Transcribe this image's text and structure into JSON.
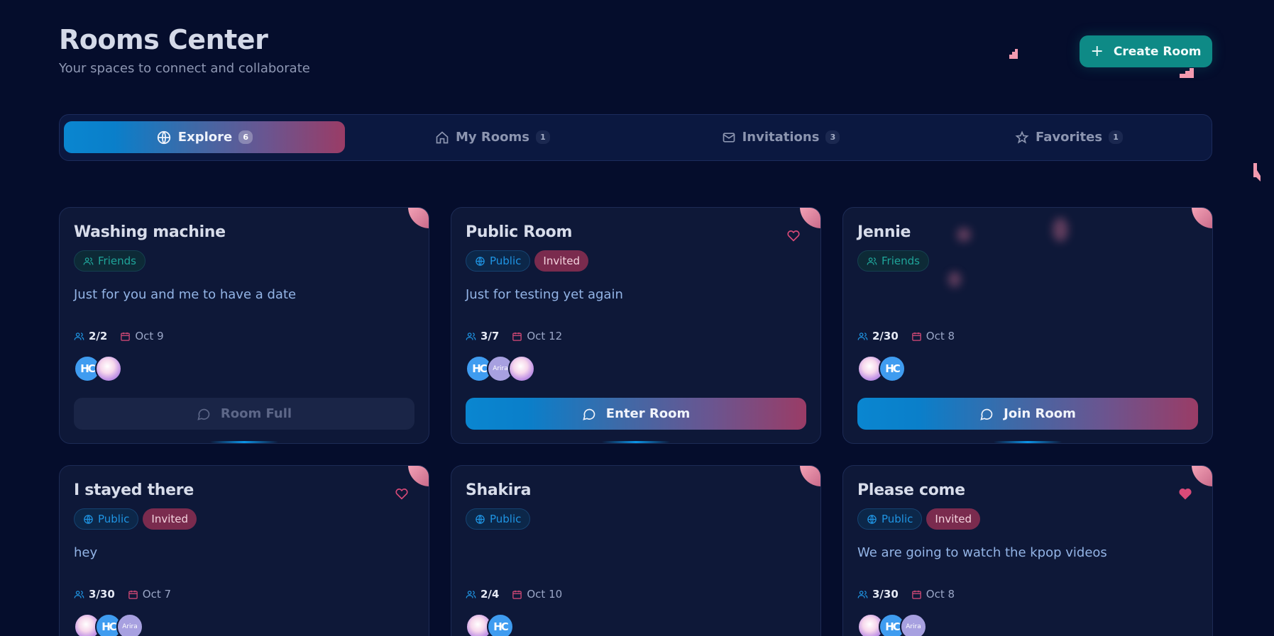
{
  "header": {
    "title": "Rooms Center",
    "subtitle": "Your spaces to connect and collaborate",
    "create_label": "Create Room"
  },
  "tabs": [
    {
      "label": "Explore",
      "count": "6",
      "icon": "globe-icon",
      "active": true
    },
    {
      "label": "My Rooms",
      "count": "1",
      "icon": "home-icon",
      "active": false
    },
    {
      "label": "Invitations",
      "count": "3",
      "icon": "mail-icon",
      "active": false
    },
    {
      "label": "Favorites",
      "count": "1",
      "icon": "star-icon",
      "active": false
    }
  ],
  "cards": [
    {
      "title": "Washing machine",
      "type": "Friends",
      "invited": "",
      "description": "Just for you and me to have a date",
      "members": "2/2",
      "date": "Oct 9",
      "favorite": "none",
      "action": "Room Full",
      "action_state": "disabled"
    },
    {
      "title": "Public Room",
      "type": "Public",
      "invited": "Invited",
      "description": "Just for testing yet again",
      "members": "3/7",
      "date": "Oct 12",
      "favorite": "outline",
      "action": "Enter Room",
      "action_state": "enabled"
    },
    {
      "title": "Jennie",
      "type": "Friends",
      "invited": "",
      "description": "",
      "members": "2/30",
      "date": "Oct 8",
      "favorite": "none",
      "action": "Join Room",
      "action_state": "enabled"
    },
    {
      "title": "I stayed there",
      "type": "Public",
      "invited": "Invited",
      "description": "hey",
      "members": "3/30",
      "date": "Oct 7",
      "favorite": "outline"
    },
    {
      "title": "Shakira",
      "type": "Public",
      "invited": "",
      "description": "",
      "members": "2/4",
      "date": "Oct 10",
      "favorite": "none"
    },
    {
      "title": "Please come",
      "type": "Public",
      "invited": "Invited",
      "description": "We are going to watch the kpop videos",
      "members": "3/30",
      "date": "Oct 8",
      "favorite": "filled"
    }
  ],
  "avatars": {
    "hc": "HC",
    "arira": "Arira"
  },
  "colors": {
    "background": "#050d2c",
    "accent_teal": "#0e8a86",
    "gradient_start": "#0a86d0",
    "gradient_end": "#9a3c66",
    "invited": "#7a2b4e",
    "favorite": "#d94a78"
  }
}
